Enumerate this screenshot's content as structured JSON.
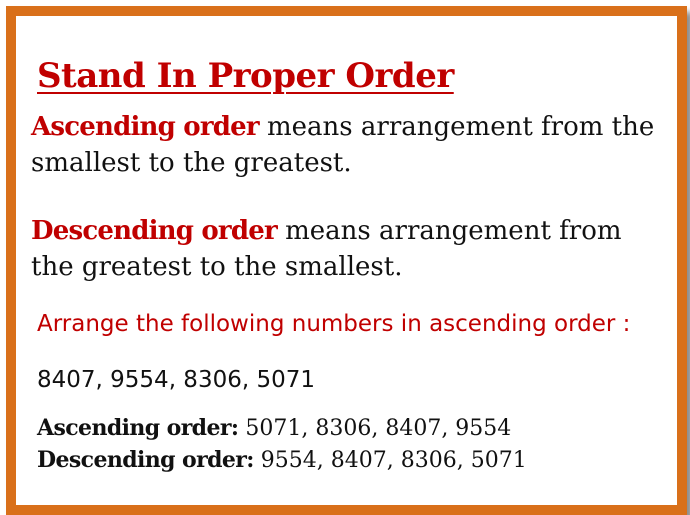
{
  "title": "Stand In Proper Order",
  "ascending_definition": {
    "term": "Ascending order",
    "text": " means arrangement from the smallest to the greatest."
  },
  "descending_definition": {
    "term": "Descending order",
    "text": " means arrangement from the greatest to the smallest."
  },
  "task": "Arrange the following numbers in ascending order :",
  "numbers": "8407, 9554, 8306, 5071",
  "answers": {
    "ascending_label": "Ascending order:",
    "ascending_values": " 5071, 8306, 8407, 9554",
    "descending_label": "Descending order:",
    "descending_values": " 9554, 8407, 8306, 5071"
  },
  "colors": {
    "frame": "#d9701a",
    "accent_red": "#c00000",
    "text": "#111111"
  }
}
